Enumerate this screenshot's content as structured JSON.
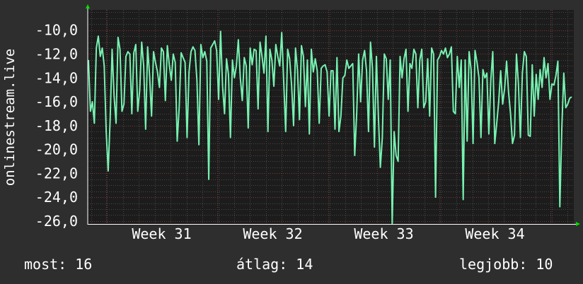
{
  "chart_data": {
    "type": "line",
    "ylabel": "onlinestream.live",
    "ylim": [
      -26.3,
      -8.3
    ],
    "yticks": [
      -10,
      -12,
      -14,
      -16,
      -18,
      -20,
      -22,
      -24,
      -26
    ],
    "ytick_labels": [
      "-10,0",
      "-12,0",
      "-14,0",
      "-16,0",
      "-18,0",
      "-20,0",
      "-22,0",
      "-24,0",
      "-26,0"
    ],
    "xticks": [
      "Week 31",
      "Week 32",
      "Week 33",
      "Week 34"
    ],
    "grid": true,
    "colors": {
      "background": "#2e2e2e",
      "plot_background": "#1c1c1c",
      "grid_minor": "#474747",
      "grid_major": "#7a3a3a",
      "line": "#77f2b1",
      "axis": "#ffffff",
      "arrow": "#00dd00"
    },
    "series": [
      {
        "values": [
          -12.5,
          -16.8,
          -16.0,
          -17.8,
          -11.5,
          -10.5,
          -12.2,
          -11.5,
          -13.0,
          -18.5,
          -21.8,
          -17.5,
          -11.6,
          -15.5,
          -17.8,
          -10.6,
          -11.6,
          -16.8,
          -16.2,
          -12.2,
          -11.8,
          -12.0,
          -17.0,
          -11.9,
          -11.2,
          -16.8,
          -15.0,
          -11.0,
          -13.0,
          -18.3,
          -11.4,
          -13.8,
          -17.2,
          -11.8,
          -12.7,
          -13.5,
          -14.8,
          -11.5,
          -11.8,
          -15.9,
          -11.3,
          -12.9,
          -14.2,
          -12.0,
          -12.7,
          -19.3,
          -16.5,
          -11.9,
          -12.3,
          -12.7,
          -19.0,
          -13.5,
          -11.8,
          -11.4,
          -11.7,
          -14.2,
          -19.6,
          -11.2,
          -12.3,
          -11.8,
          -12.6,
          -22.5,
          -11.5,
          -11.2,
          -10.9,
          -11.7,
          -15.8,
          -10.1,
          -14.7,
          -17.0,
          -12.4,
          -13.7,
          -19.0,
          -12.5,
          -14.0,
          -13.0,
          -10.8,
          -14.0,
          -15.9,
          -12.3,
          -13.0,
          -18.2,
          -11.5,
          -12.9,
          -11.6,
          -11.7,
          -16.6,
          -11.0,
          -12.2,
          -13.6,
          -10.5,
          -18.5,
          -11.6,
          -12.5,
          -14.7,
          -11.2,
          -12.2,
          -13.0,
          -10.2,
          -14.3,
          -18.5,
          -11.6,
          -12.4,
          -14.6,
          -18.0,
          -11.5,
          -13.4,
          -17.5,
          -11.3,
          -12.2,
          -16.4,
          -12.5,
          -18.7,
          -11.6,
          -13.5,
          -12.4,
          -13.4,
          -17.8,
          -13.2,
          -13.0,
          -12.9,
          -13.5,
          -17.2,
          -13.4,
          -13.4,
          -18.3,
          -12.3,
          -18.5,
          -17.2,
          -14.0,
          -13.8,
          -12.5,
          -13.2,
          -13.0,
          -12.8,
          -20.5,
          -17.0,
          -12.0,
          -16.0,
          -12.5,
          -11.7,
          -13.4,
          -18.5,
          -11.0,
          -13.2,
          -19.8,
          -12.2,
          -17.2,
          -21.5,
          -19.0,
          -12.0,
          -12.4,
          -15.8,
          -12.5,
          -26.2,
          -18.5,
          -20.5,
          -21.0,
          -12.2,
          -14.0,
          -12.4,
          -11.6,
          -16.8,
          -12.8,
          -13.2,
          -11.6,
          -12.0,
          -16.5,
          -12.5,
          -11.6,
          -16.5,
          -16.0,
          -12.4,
          -17.2,
          -11.5,
          -12.0,
          -24.0,
          -12.5,
          -12.2,
          -11.7,
          -12.0,
          -11.5,
          -12.3,
          -12.0,
          -11.4,
          -16.8,
          -17.0,
          -12.2,
          -14.8,
          -12.5,
          -24.2,
          -12.5,
          -19.3,
          -11.8,
          -13.3,
          -19.5,
          -11.7,
          -12.7,
          -14.0,
          -19.0,
          -13.3,
          -14.0,
          -13.6,
          -18.7,
          -14.2,
          -11.8,
          -19.5,
          -17.8,
          -16.0,
          -13.4,
          -16.2,
          -14.9,
          -12.6,
          -15.2,
          -17.0,
          -19.5,
          -18.8,
          -12.0,
          -14.5,
          -19.0,
          -13.6,
          -11.8,
          -12.2,
          -18.8,
          -18.9,
          -12.9,
          -17.2,
          -13.7,
          -15.8,
          -13.3,
          -14.8,
          -12.3,
          -14.0,
          -12.8,
          -15.8,
          -14.5,
          -14.6,
          -13.8,
          -12.6,
          -24.8,
          -18.2,
          -13.6,
          -16.5,
          -16.2,
          -15.7,
          -15.6
        ]
      }
    ]
  },
  "footer": {
    "current": "most: 16",
    "average": "átlag: 14",
    "best": "legjobb: 10"
  }
}
